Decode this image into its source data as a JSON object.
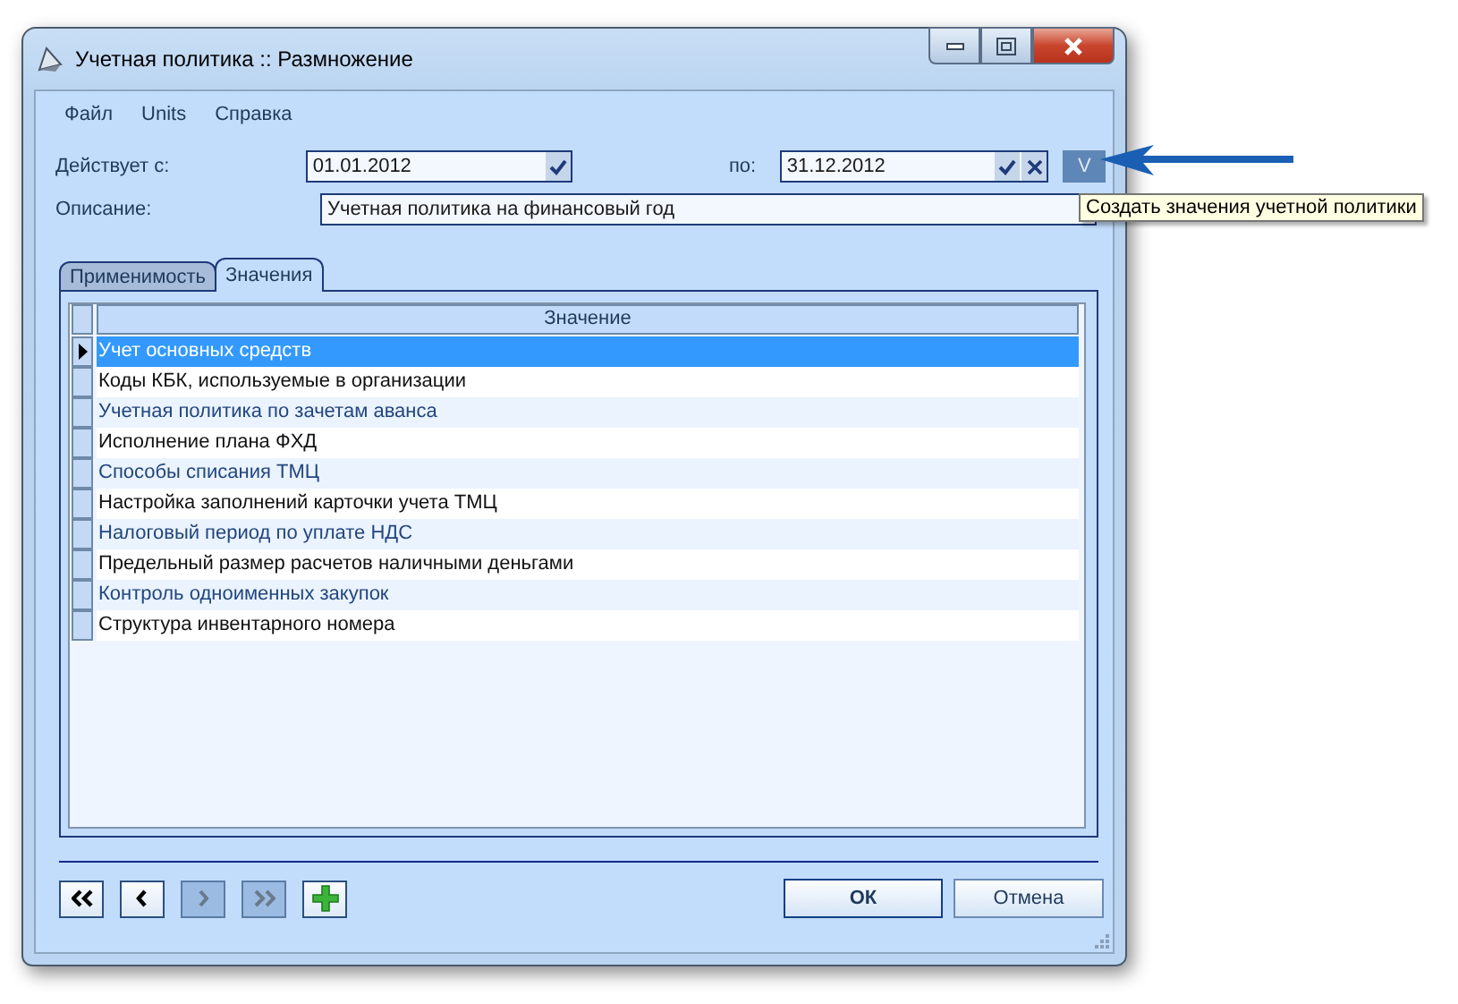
{
  "window": {
    "title": "Учетная политика :: Размножение"
  },
  "menu": [
    {
      "label": "Файл"
    },
    {
      "label": "Units"
    },
    {
      "label": "Справка"
    }
  ],
  "valid_from": {
    "label": "Действует с:",
    "value": "01.01.2012"
  },
  "valid_to": {
    "label": "по:",
    "value": "31.12.2012"
  },
  "create_button": {
    "label": "V"
  },
  "tooltip": {
    "text": "Создать значения учетной политики"
  },
  "description": {
    "label": "Описание:",
    "value": "Учетная политика на финансовый год"
  },
  "tabs": [
    {
      "label": "Применимость",
      "selected": false
    },
    {
      "label": "Значения",
      "selected": true
    }
  ],
  "table": {
    "columns": [
      "Значение"
    ],
    "rows": [
      {
        "value": "Учет основных средств",
        "selected": true
      },
      {
        "value": "Коды КБК, используемые в организации",
        "selected": false
      },
      {
        "value": "Учетная политика по зачетам аванса",
        "selected": false
      },
      {
        "value": "Исполнение плана ФХД",
        "selected": false
      },
      {
        "value": "Способы списания ТМЦ",
        "selected": false
      },
      {
        "value": "Настройка заполнений карточки учета ТМЦ",
        "selected": false
      },
      {
        "value": "Налоговый период по уплате НДС",
        "selected": false
      },
      {
        "value": "Предельный размер расчетов наличными деньгами",
        "selected": false
      },
      {
        "value": "Контроль одноименных закупок",
        "selected": false
      },
      {
        "value": "Структура инвентарного номера",
        "selected": false
      }
    ]
  },
  "nav_buttons": [
    {
      "kind": "first",
      "disabled": false
    },
    {
      "kind": "prev",
      "disabled": false
    },
    {
      "kind": "next",
      "disabled": true
    },
    {
      "kind": "last",
      "disabled": true
    },
    {
      "kind": "add",
      "disabled": false
    }
  ],
  "buttons": [
    {
      "label": "ОК",
      "kind": "default"
    },
    {
      "label": "Отмена",
      "kind": "normal"
    }
  ]
}
